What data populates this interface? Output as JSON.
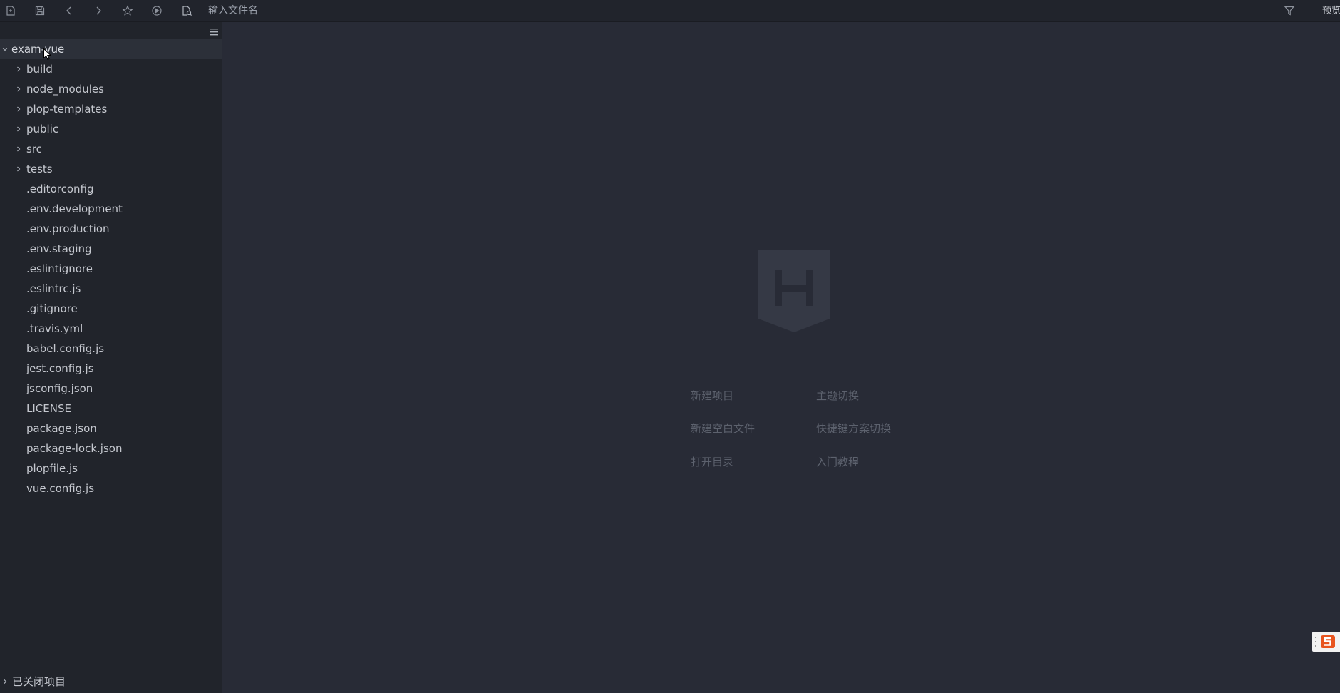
{
  "toolbar": {
    "filename_placeholder": "输入文件名",
    "preview_label": "预览"
  },
  "sidebar": {
    "root_project": "exam-vue",
    "folders": [
      "build",
      "node_modules",
      "plop-templates",
      "public",
      "src",
      "tests"
    ],
    "files": [
      ".editorconfig",
      ".env.development",
      ".env.production",
      ".env.staging",
      ".eslintignore",
      ".eslintrc.js",
      ".gitignore",
      ".travis.yml",
      "babel.config.js",
      "jest.config.js",
      "jsconfig.json",
      "LICENSE",
      "package.json",
      "package-lock.json",
      "plopfile.js",
      "vue.config.js"
    ],
    "closed_projects_label": "已关闭项目"
  },
  "welcome": {
    "links": {
      "new_project": "新建项目",
      "theme_switch": "主题切换",
      "new_blank_file": "新建空白文件",
      "keymap_switch": "快捷键方案切换",
      "open_directory": "打开目录",
      "tutorial": "入门教程"
    }
  },
  "colors": {
    "toolbar_bg": "#21242c",
    "sidebar_bg": "#21242b",
    "editor_bg": "#282b36",
    "text": "#c5c8cf",
    "muted_link": "#5d626e",
    "badge_accent": "#e8541e"
  },
  "icons": [
    "new-file-icon",
    "save-icon",
    "back-icon",
    "forward-icon",
    "star-icon",
    "run-icon",
    "preview-file-icon",
    "filter-icon",
    "collapse-menu-icon",
    "chevron-right-icon",
    "chevron-down-icon",
    "hbuilder-logo-icon",
    "input-method-icon"
  ]
}
